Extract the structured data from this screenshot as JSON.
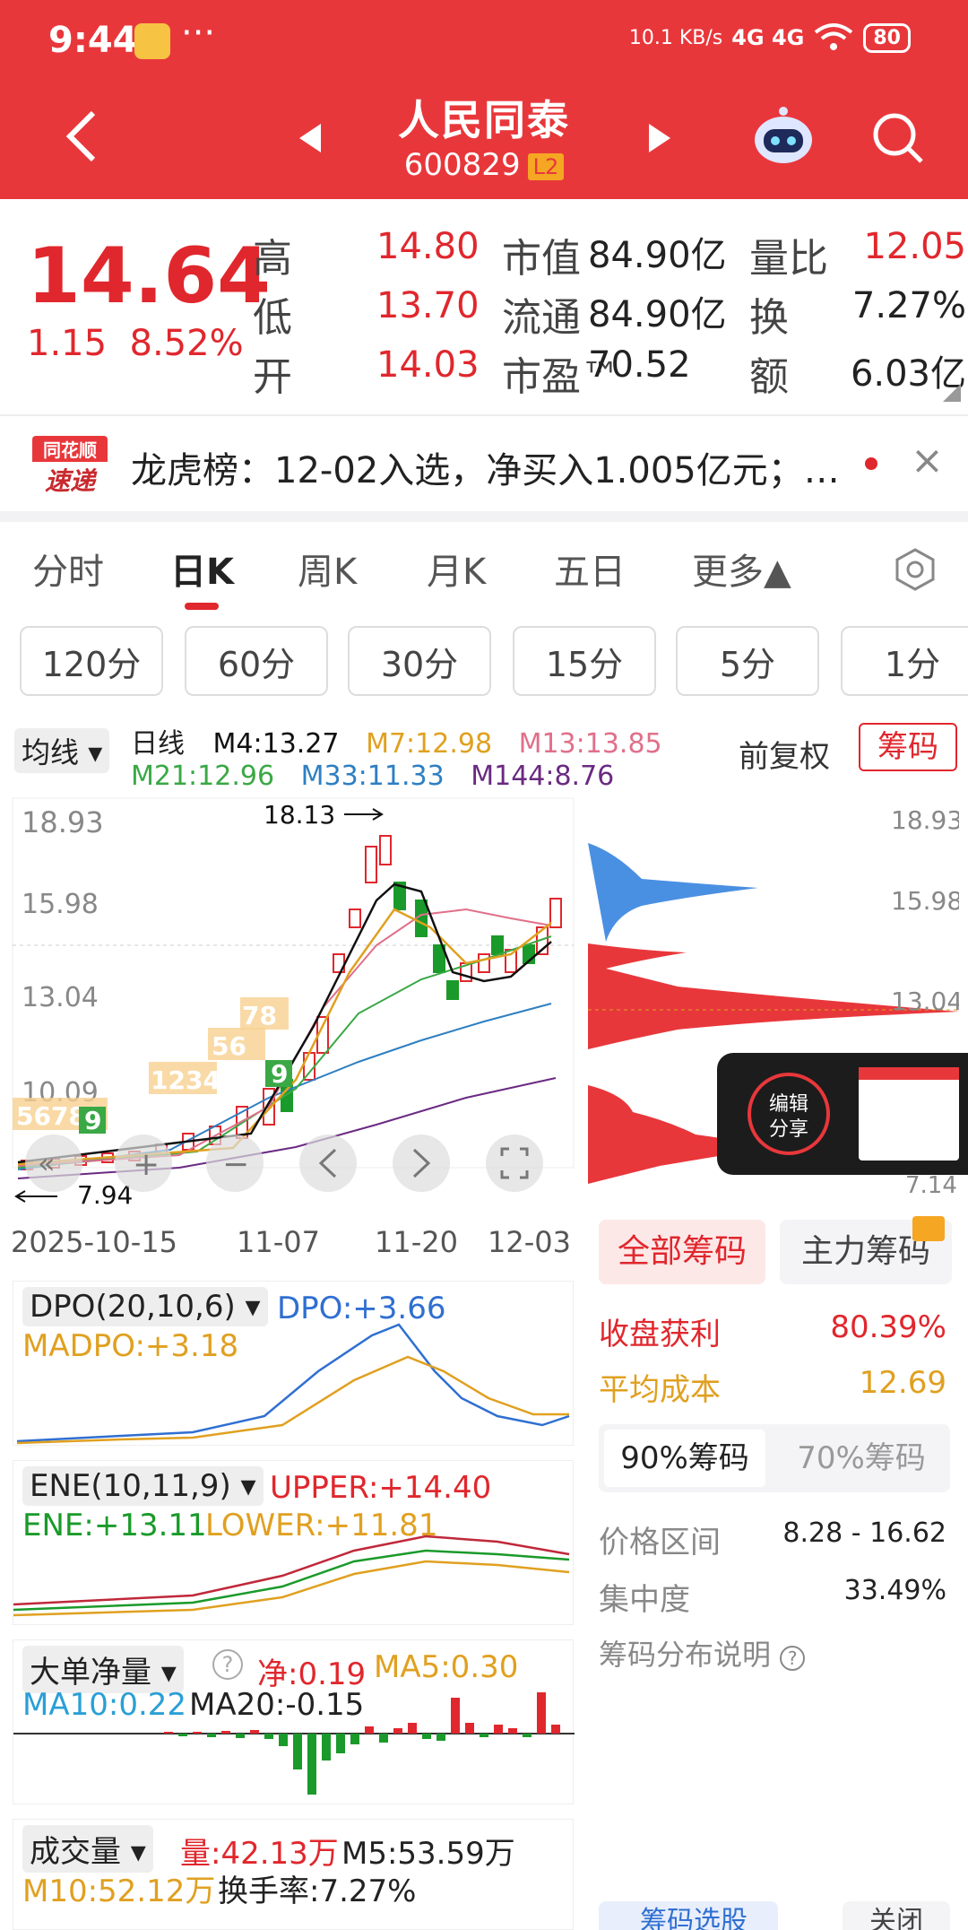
{
  "status_bar": {
    "time": "9:44",
    "dots": "···",
    "net_speed": "10.1 KB/s",
    "signal": "4G 4G",
    "battery": "80"
  },
  "header": {
    "title": "人民同泰",
    "code": "600829",
    "badge": "L2"
  },
  "quote": {
    "price": "14.64",
    "change": "1.15",
    "change_pct": "8.52%",
    "rows": [
      {
        "l1": "高",
        "v1": "14.80",
        "l2": "市值",
        "v2": "84.90亿",
        "l3": "量比",
        "v3": "12.05"
      },
      {
        "l1": "低",
        "v1": "13.70",
        "l2": "流通",
        "v2": "84.90亿",
        "l3": "换",
        "v3": "7.27%"
      },
      {
        "l1": "开",
        "v1": "14.03",
        "l2": "市盈™",
        "v2": "70.52",
        "l3": "额",
        "v3": "6.03亿"
      }
    ]
  },
  "news": {
    "logo_top": "同花顺",
    "logo_bottom": "速递",
    "text": "龙虎榜：12-02入选，净买入1.005亿元；…",
    "close": "×"
  },
  "tabs": [
    "分时",
    "日K",
    "周K",
    "月K",
    "五日",
    "更多▲"
  ],
  "periods": [
    "120分",
    "60分",
    "30分",
    "15分",
    "5分",
    "1分"
  ],
  "kline": {
    "ma_selector": "均线",
    "line_type": "日线",
    "ma": [
      {
        "label": "M4:13.27",
        "color": "#111111"
      },
      {
        "label": "M7:12.98",
        "color": "#e0a020"
      },
      {
        "label": "M13:13.85",
        "color": "#e0708a"
      },
      {
        "label": "M21:12.96",
        "color": "#3aa845"
      },
      {
        "label": "M33:11.33",
        "color": "#2f7fc1"
      },
      {
        "label": "M144:8.76",
        "color": "#6a2a82"
      }
    ],
    "adjust": "前复权",
    "chip_btn": "筹码",
    "y_labels": [
      "18.93",
      "15.98",
      "13.04",
      "10.09"
    ],
    "max_label": "18.13",
    "min_label": "7.94",
    "x_labels": [
      "2025-10-15",
      "11-07",
      "11-20",
      "12-03"
    ],
    "nine_turn": "1234 5678 9"
  },
  "chip_axis": [
    "18.93",
    "15.98",
    "13.04",
    "7.14"
  ],
  "float_widget": {
    "label1": "编辑",
    "label2": "分享"
  },
  "chip_panel": {
    "tabs": [
      "全部筹码",
      "主力筹码"
    ],
    "profit_label": "收盘获利",
    "profit_value": "80.39%",
    "cost_label": "平均成本",
    "cost_value": "12.69",
    "ratio_tabs": [
      "90%筹码",
      "70%筹码"
    ],
    "range_label": "价格区间",
    "range_value": "8.28 - 16.62",
    "conc_label": "集中度",
    "conc_value": "33.49%",
    "explain": "筹码分布说明",
    "select_btn": "筹码选股",
    "close_btn": "关闭"
  },
  "indicators": {
    "dpo": {
      "name": "DPO(20,10,6)",
      "v1": "DPO:+3.66",
      "v2": "MADPO:+3.18"
    },
    "ene": {
      "name": "ENE(10,11,9)",
      "v1": "UPPER:+14.40",
      "v2": "ENE:+13.11",
      "v3": "LOWER:+11.81"
    },
    "big": {
      "name": "大单净量",
      "v1": "净:0.19",
      "v2": "MA5:0.30",
      "v3": "MA10:0.22",
      "v4": "MA20:-0.15"
    },
    "vol": {
      "name": "成交量",
      "v1": "量:42.13万",
      "v2": "M5:53.59万",
      "v3": "M10:52.12万",
      "v4": "换手率:7.27%"
    }
  }
}
